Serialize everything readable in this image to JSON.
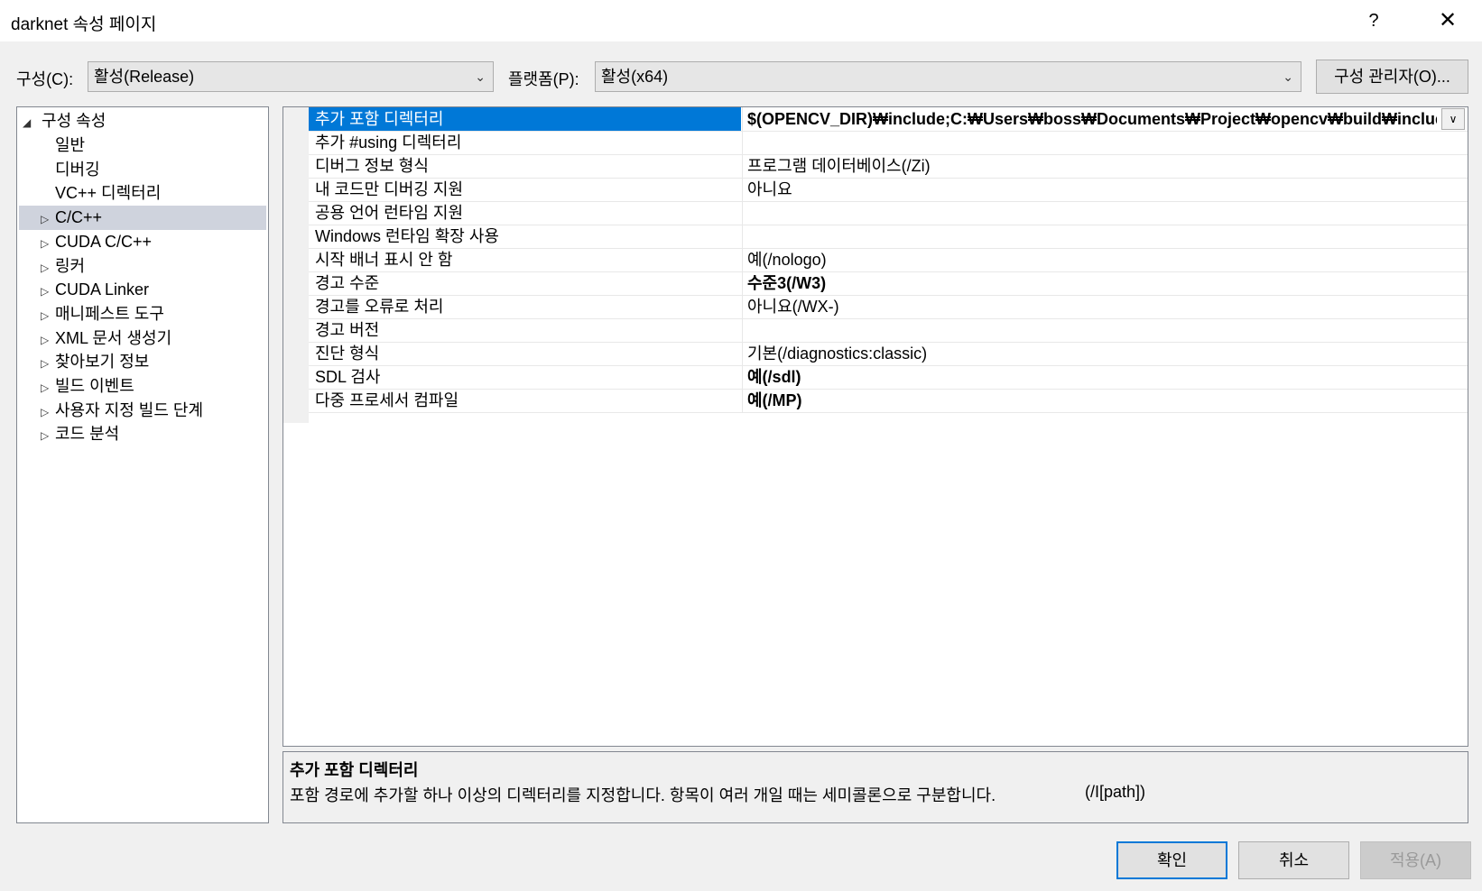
{
  "window": {
    "title": "darknet 속성 페이지",
    "help_label": "?",
    "close_label": "✕"
  },
  "toolbar": {
    "config_label": "구성(C):",
    "config_value": "활성(Release)",
    "platform_label": "플랫폼(P):",
    "platform_value": "활성(x64)",
    "manager_label": "구성 관리자(O)..."
  },
  "tree": {
    "root": "구성 속성",
    "items": [
      {
        "label": "일반",
        "expandable": false
      },
      {
        "label": "디버깅",
        "expandable": false
      },
      {
        "label": "VC++ 디렉터리",
        "expandable": false
      },
      {
        "label": "C/C++",
        "expandable": true,
        "selected": true
      },
      {
        "label": "CUDA C/C++",
        "expandable": true
      },
      {
        "label": "링커",
        "expandable": true
      },
      {
        "label": "CUDA Linker",
        "expandable": true
      },
      {
        "label": "매니페스트 도구",
        "expandable": true
      },
      {
        "label": "XML 문서 생성기",
        "expandable": true
      },
      {
        "label": "찾아보기 정보",
        "expandable": true
      },
      {
        "label": "빌드 이벤트",
        "expandable": true
      },
      {
        "label": "사용자 지정 빌드 단계",
        "expandable": true
      },
      {
        "label": "코드 분석",
        "expandable": true
      }
    ]
  },
  "properties": [
    {
      "name": "추가 포함 디렉터리",
      "value": "$(OPENCV_DIR)₩include;C:₩Users₩boss₩Documents₩Project₩opencv₩build₩include;..₩.",
      "bold": true,
      "selected": true
    },
    {
      "name": "추가 #using 디렉터리",
      "value": "",
      "bold": false
    },
    {
      "name": "디버그 정보 형식",
      "value": "프로그램 데이터베이스(/Zi)",
      "bold": false
    },
    {
      "name": "내 코드만 디버깅 지원",
      "value": "아니요",
      "bold": false
    },
    {
      "name": "공용 언어 런타임 지원",
      "value": "",
      "bold": false
    },
    {
      "name": "Windows 런타임 확장 사용",
      "value": "",
      "bold": false
    },
    {
      "name": "시작 배너 표시 안 함",
      "value": "예(/nologo)",
      "bold": false
    },
    {
      "name": "경고 수준",
      "value": "수준3(/W3)",
      "bold": true
    },
    {
      "name": "경고를 오류로 처리",
      "value": "아니요(/WX-)",
      "bold": false
    },
    {
      "name": "경고 버전",
      "value": "",
      "bold": false
    },
    {
      "name": "진단 형식",
      "value": "기본(/diagnostics:classic)",
      "bold": false
    },
    {
      "name": "SDL 검사",
      "value": "예(/sdl)",
      "bold": true
    },
    {
      "name": "다중 프로세서 컴파일",
      "value": "예(/MP)",
      "bold": true
    }
  ],
  "description": {
    "title": "추가 포함 디렉터리",
    "text": "포함 경로에 추가할 하나 이상의 디렉터리를 지정합니다. 항목이 여러 개일 때는 세미콜론으로 구분합니다.",
    "flag": "(/I[path])"
  },
  "buttons": {
    "ok": "확인",
    "cancel": "취소",
    "apply": "적용(A)"
  },
  "colors": {
    "selection": "#0078d7",
    "tree_selection": "#cfd3dd"
  }
}
